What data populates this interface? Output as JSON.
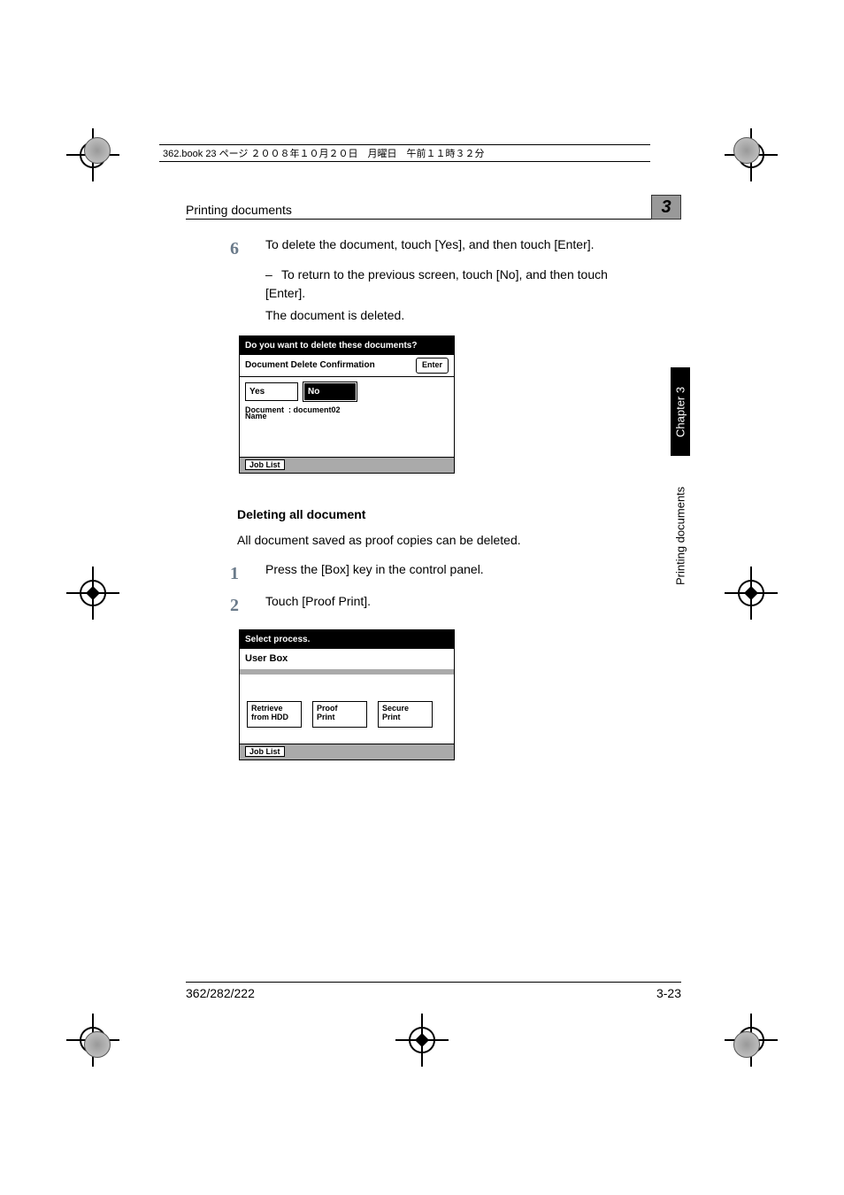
{
  "page_meta": "362.book  23 ページ  ２００８年１０月２０日　月曜日　午前１１時３２分",
  "header": {
    "title": "Printing documents",
    "chapter_num": "3"
  },
  "side": {
    "chapter": "Chapter 3",
    "section": "Printing documents"
  },
  "steps": {
    "six": {
      "num": "6",
      "text": "To delete the document, touch [Yes], and then touch [Enter].",
      "sub": "To return to the previous screen, touch [No], and then touch [Enter].",
      "result": "The document is deleted."
    },
    "one": {
      "num": "1",
      "text": "Press the [Box] key in the control panel."
    },
    "two": {
      "num": "2",
      "text": "Touch [Proof Print]."
    }
  },
  "panel1": {
    "title": "Do you want to delete these documents?",
    "subtitle": "Document Delete Confirmation",
    "enter": "Enter",
    "yes": "Yes",
    "no": "No",
    "docname_label1": "Document",
    "docname_label2": "Name",
    "docname_value": ": document02",
    "joblist": "Job List"
  },
  "section": {
    "title": "Deleting all document",
    "body": "All document saved as proof copies can be deleted."
  },
  "panel2": {
    "title": "Select process.",
    "userbox": "User Box",
    "btn1a": "Retrieve",
    "btn1b": "from HDD",
    "btn2a": "Proof",
    "btn2b": "Print",
    "btn3a": "Secure",
    "btn3b": "Print",
    "joblist": "Job List"
  },
  "footer": {
    "left": "362/282/222",
    "right": "3-23"
  }
}
